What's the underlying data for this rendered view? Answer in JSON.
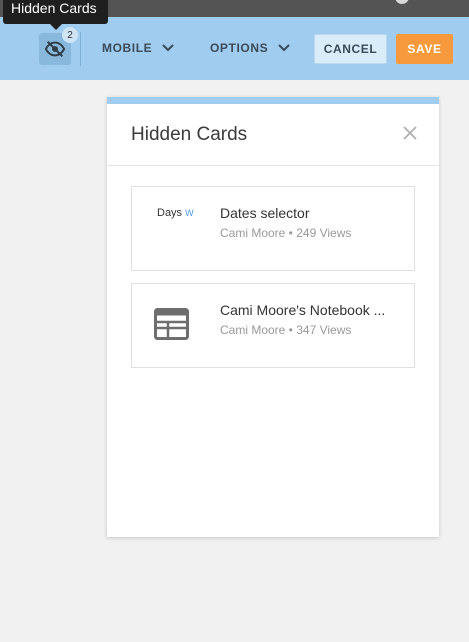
{
  "tooltip": {
    "text": "Hidden Cards"
  },
  "toolbar": {
    "hidden_count": "2",
    "hidden_icon": "eye-off-icon",
    "mobile_label": "MOBILE",
    "options_label": "OPTIONS",
    "cancel_label": "CANCEL",
    "save_label": "SAVE"
  },
  "panel": {
    "title": "Hidden Cards",
    "close_icon": "close-icon",
    "cards": [
      {
        "thumb_label": "Days",
        "thumb_accent": "W",
        "title": "Dates selector",
        "meta": "Cami Moore • 249 Views"
      },
      {
        "thumb_icon": "table-icon",
        "title": "Cami Moore's Notebook ...",
        "meta": "Cami Moore • 347 Views"
      }
    ]
  },
  "colors": {
    "toolbar_bg": "#9fccef",
    "save_bg": "#f79a3e",
    "topbar_bg": "#545454"
  }
}
